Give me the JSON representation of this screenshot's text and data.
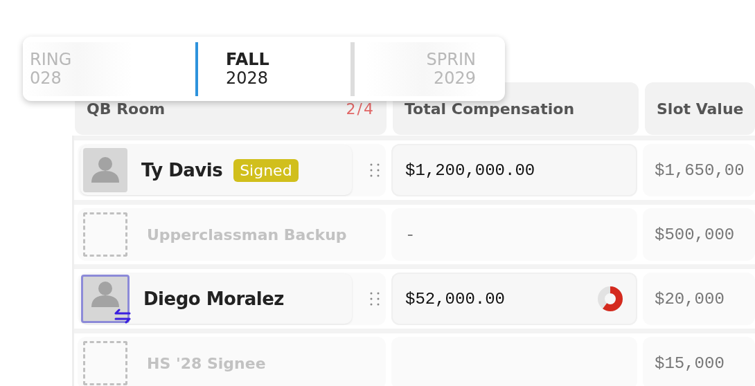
{
  "season_picker": [
    {
      "term": "RING",
      "year": "028",
      "selected": false
    },
    {
      "term": "FALL",
      "year": "2028",
      "selected": true
    },
    {
      "term": "SPRIN",
      "year": "2029",
      "selected": false
    }
  ],
  "table": {
    "columns": [
      {
        "label": "QB Room",
        "count": "2/4"
      },
      {
        "label": "Total Compensation"
      },
      {
        "label": "Slot Value"
      }
    ],
    "rows": [
      {
        "kind": "player",
        "name": "Ty Davis",
        "badge": "Signed",
        "transfer": false,
        "compensation": "$1,200,000.00",
        "slot_value": "$1,650,00"
      },
      {
        "kind": "open",
        "name": "Upperclassman Backup",
        "compensation": "-",
        "slot_value": "$500,000"
      },
      {
        "kind": "player",
        "name": "Diego Moralez",
        "transfer": true,
        "compensation": "$52,000.00",
        "progress_ring": true,
        "slot_value": "$20,000"
      },
      {
        "kind": "open",
        "name": "HS '28 Signee",
        "slot_value": "$15,000"
      }
    ]
  }
}
